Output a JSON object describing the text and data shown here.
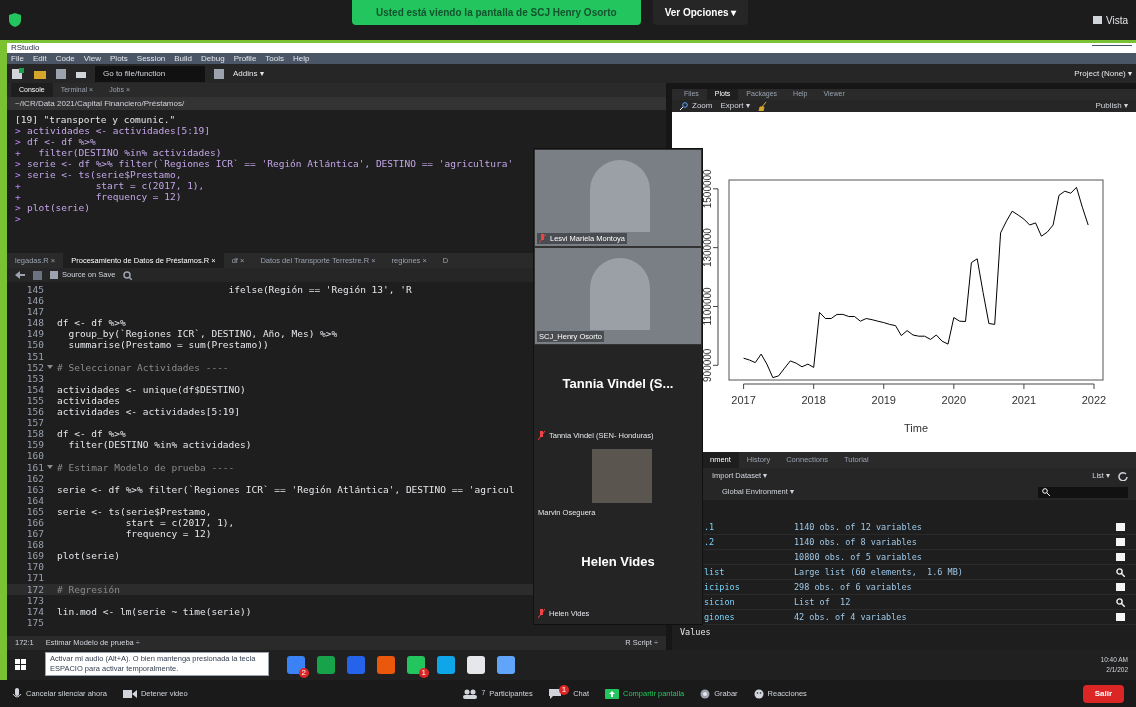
{
  "zoom_top": {
    "banner": "Usted está viendo la pantalla de SCJ Henry Osorto",
    "options_button": "Ver Opciones ▾",
    "view_button": "Vista"
  },
  "rstudio": {
    "window_title": "RStudio",
    "menu": [
      "File",
      "Edit",
      "Code",
      "View",
      "Plots",
      "Session",
      "Build",
      "Debug",
      "Profile",
      "Tools",
      "Help"
    ],
    "toolbar": {
      "goto_placeholder": "Go to file/function",
      "addins": "Addins ▾",
      "project": "Project (None) ▾"
    },
    "console": {
      "tabs": [
        {
          "label": "Console",
          "selected": true
        },
        {
          "label": "Terminal ×",
          "selected": false
        },
        {
          "label": "Jobs ×",
          "selected": false
        }
      ],
      "path": "~/ICR/Data 2021/Capital Financiero/Préstamos/",
      "lines": [
        {
          "text": "[19] \"transporte y comunic.\""
        },
        {
          "prompt": ">",
          "text": "actividades <- actividades[5:19]"
        },
        {
          "prompt": ">",
          "text": "df <- df %>%"
        },
        {
          "prompt": "+",
          "text": "  filter(DESTINO %in% actividades)"
        },
        {
          "prompt": ">",
          "text": "serie <- df %>% filter(`Regiones ICR` == 'Región Atlántica', DESTINO == 'agricultura'"
        },
        {
          "prompt": ">",
          "text": "serie <- ts(serie$Prestamo,"
        },
        {
          "prompt": "+",
          "text": "            start = c(2017, 1),"
        },
        {
          "prompt": "+",
          "text": "            frequency = 12)"
        },
        {
          "prompt": ">",
          "text": "plot(serie)"
        },
        {
          "prompt": ">"
        }
      ]
    },
    "editor": {
      "tabs": [
        {
          "label": "legadas.R ×",
          "selected": false
        },
        {
          "label": "Procesamiento de Datos de Préstamos.R ×",
          "selected": true
        },
        {
          "label": "df ×",
          "selected": false
        },
        {
          "label": "Datos del Transporte Terrestre.R ×",
          "selected": false
        },
        {
          "label": "regiones ×",
          "selected": false
        },
        {
          "label": "D",
          "selected": false
        }
      ],
      "source_on_save": {
        "label": "Source on Save",
        "checked": false
      },
      "lines": [
        {
          "number": "145",
          "text": "                              ifelse(Región == 'Región 13', 'R",
          "kind": "code",
          "fold": false,
          "current": false
        },
        {
          "number": "146",
          "fold": false,
          "current": false
        },
        {
          "number": "147",
          "fold": false,
          "current": false
        },
        {
          "number": "148",
          "text": "df <- df %>%",
          "kind": "code",
          "fold": false,
          "current": false
        },
        {
          "number": "149",
          "text": "  group_by(`Regiones ICR`, DESTINO, Año, Mes) %>%",
          "kind": "code",
          "fold": false,
          "current": false
        },
        {
          "number": "150",
          "text": "  summarise(Prestamo = sum(Prestamo))",
          "kind": "code",
          "fold": false,
          "current": false
        },
        {
          "number": "151",
          "fold": false,
          "current": false
        },
        {
          "number": "152",
          "text": "# Seleccionar Actividades ----",
          "kind": "comment",
          "fold": true,
          "current": false
        },
        {
          "number": "153",
          "fold": false,
          "current": false
        },
        {
          "number": "154",
          "text": "actividades <- unique(df$DESTINO)",
          "kind": "code",
          "fold": false,
          "current": false
        },
        {
          "number": "155",
          "text": "actividades",
          "kind": "code",
          "fold": false,
          "current": false
        },
        {
          "number": "156",
          "text": "actividades <- actividades[5:19]",
          "kind": "code",
          "fold": false,
          "current": false
        },
        {
          "number": "157",
          "fold": false,
          "current": false
        },
        {
          "number": "158",
          "text": "df <- df %>%",
          "kind": "code",
          "fold": false,
          "current": false
        },
        {
          "number": "159",
          "text": "  filter(DESTINO %in% actividades)",
          "kind": "code",
          "fold": false,
          "current": false
        },
        {
          "number": "160",
          "fold": false,
          "current": false
        },
        {
          "number": "161",
          "text": "# Estimar Modelo de prueba ----",
          "kind": "comment",
          "fold": true,
          "current": false
        },
        {
          "number": "162",
          "fold": false,
          "current": false
        },
        {
          "number": "163",
          "text": "serie <- df %>% filter(`Regiones ICR` == 'Región Atlántica', DESTINO == 'agricul",
          "kind": "code",
          "fold": false,
          "current": false
        },
        {
          "number": "164",
          "fold": false,
          "current": false
        },
        {
          "number": "165",
          "text": "serie <- ts(serie$Prestamo,",
          "kind": "code",
          "fold": false,
          "current": false
        },
        {
          "number": "166",
          "text": "            start = c(2017, 1),",
          "kind": "code",
          "fold": false,
          "current": false
        },
        {
          "number": "167",
          "text": "            frequency = 12)",
          "kind": "code",
          "fold": false,
          "current": false
        },
        {
          "number": "168",
          "fold": false,
          "current": false
        },
        {
          "number": "169",
          "text": "plot(serie)",
          "kind": "code",
          "fold": false,
          "current": false
        },
        {
          "number": "170",
          "fold": false,
          "current": false
        },
        {
          "number": "171",
          "fold": false,
          "current": false
        },
        {
          "number": "172",
          "text": "# Regresión",
          "kind": "comment",
          "fold": false,
          "current": true
        },
        {
          "number": "173",
          "fold": false,
          "current": false
        },
        {
          "number": "174",
          "text": "lin.mod <- lm(serie ~ time(serie))",
          "kind": "code",
          "fold": false,
          "current": false
        },
        {
          "number": "175",
          "fold": false,
          "current": false
        }
      ],
      "position": "172:1",
      "section": "Estimar Modelo de prueba ÷",
      "file_type": "R Script ÷"
    },
    "plots": {
      "tabs": [
        {
          "label": "Files",
          "selected": false
        },
        {
          "label": "Plots",
          "selected": true
        },
        {
          "label": "Packages",
          "selected": false
        },
        {
          "label": "Help",
          "selected": false
        },
        {
          "label": "Viewer",
          "selected": false
        }
      ],
      "zoom": "Zoom",
      "export": "Export ▾",
      "publish": "Publish ▾",
      "chart_data": {
        "type": "line",
        "xlabel": "Time",
        "xlim": [
          2017,
          2022
        ],
        "ylim": [
          850000,
          1530000
        ],
        "xticks": [
          2017,
          2018,
          2019,
          2020,
          2021,
          2022
        ],
        "yticks": [
          900000,
          1100000,
          1300000,
          1500000
        ],
        "x": [
          2017.0,
          2017.083,
          2017.167,
          2017.25,
          2017.333,
          2017.417,
          2017.5,
          2017.583,
          2017.667,
          2017.75,
          2017.833,
          2017.917,
          2018.0,
          2018.083,
          2018.167,
          2018.25,
          2018.333,
          2018.417,
          2018.5,
          2018.583,
          2018.667,
          2018.75,
          2018.833,
          2018.917,
          2019.0,
          2019.083,
          2019.167,
          2019.25,
          2019.333,
          2019.417,
          2019.5,
          2019.583,
          2019.667,
          2019.75,
          2019.833,
          2019.917,
          2020.0,
          2020.083,
          2020.167,
          2020.25,
          2020.333,
          2020.417,
          2020.5,
          2020.583,
          2020.667,
          2020.75,
          2020.833,
          2020.917,
          2021.0,
          2021.083,
          2021.167,
          2021.25,
          2021.333,
          2021.417,
          2021.5,
          2021.583,
          2021.667,
          2021.75,
          2021.833,
          2021.917
        ],
        "series": [
          {
            "color": "#000000",
            "values": [
              924000,
              918000,
              909000,
              938000,
              904000,
              858000,
              864000,
              890000,
              915000,
              907000,
              895000,
              904000,
              893000,
              1080000,
              1059000,
              1059000,
              1073000,
              1073000,
              1066000,
              1066000,
              1050000,
              1059000,
              1055000,
              1050000,
              1045000,
              1039000,
              1035000,
              1001000,
              1018000,
              1003000,
              999000,
              999000,
              988000,
              1003000,
              982000,
              972000,
              1062000,
              1050000,
              1049000,
              1249000,
              1262000,
              1147000,
              1042000,
              1039000,
              1350000,
              1390000,
              1424000,
              1411000,
              1397000,
              1377000,
              1384000,
              1339000,
              1353000,
              1377000,
              1478000,
              1492000,
              1485000,
              1505000,
              1438000,
              1377000
            ]
          }
        ]
      }
    },
    "environment": {
      "tabs": [
        {
          "label": "nment",
          "selected": true
        },
        {
          "label": "History",
          "selected": false
        },
        {
          "label": "Connections",
          "selected": false
        },
        {
          "label": "Tutorial",
          "selected": false
        }
      ],
      "import_dataset": "Import Dataset ▾",
      "scope": "Global Environment ▾",
      "list_view": "List ▾",
      "rows": [
        {
          "name": ".1",
          "value": "1140 obs. of 12 variables",
          "kind": "data"
        },
        {
          "name": ".2",
          "value": "1140 obs. of 8 variables",
          "kind": "data"
        },
        {
          "value": "10800 obs. of 5 variables",
          "kind": "data"
        },
        {
          "name": "list",
          "value": "Large list (60 elements,  1.6 MB)",
          "kind": "list"
        },
        {
          "name": "icipios",
          "value": "298 obs. of 6 variables",
          "kind": "data"
        },
        {
          "name": "sicion",
          "value": "List of  12",
          "kind": "list"
        },
        {
          "name": "giones",
          "value": "42 obs. of 4 variables",
          "kind": "data"
        }
      ],
      "values_header": "Values"
    }
  },
  "participants": [
    {
      "kind": "video",
      "name": "Lesvi Mariela Montoya",
      "muted": true
    },
    {
      "kind": "video",
      "name": "SCJ_Henry Osorto",
      "muted": false
    },
    {
      "kind": "name",
      "display_name": "Tannia Vindel (S...",
      "name": "Tannia Vindel (SEN- Honduras)",
      "muted": true
    },
    {
      "kind": "small_video",
      "name": "Marvin Oseguera",
      "muted": false
    },
    {
      "kind": "name",
      "display_name": "Helen Vides",
      "name": "Helen Vides",
      "muted": true
    }
  ],
  "taskbar": {
    "tooltip": "Activar mi audio (Alt+A). O bien mantenga presionada la tecla ESPACIO para activar temporalmente.",
    "apps": [
      {
        "color": "#3b82f6",
        "badge": "2"
      },
      {
        "color": "#16a34a"
      },
      {
        "color": "#2563eb"
      },
      {
        "color": "#ea580c"
      },
      {
        "color": "#22c55e",
        "badge": "1"
      },
      {
        "color": "#0ea5e9"
      },
      {
        "color": "#e5e7eb"
      },
      {
        "color": "#60a5fa"
      }
    ],
    "time": "10:40 AM",
    "date": "2/1/202"
  },
  "zoom_bottom": [
    {
      "kind": "mic",
      "label": "Cancelar silenciar ahora"
    },
    {
      "kind": "video",
      "label": "Detener video"
    },
    {
      "kind": "participants",
      "label": "Participantes",
      "count": "7"
    },
    {
      "kind": "chat",
      "label": "Chat",
      "badge": "1"
    },
    {
      "kind": "share",
      "label": "Compartir pantalla"
    },
    {
      "kind": "record",
      "label": "Grabar"
    },
    {
      "kind": "reactions",
      "label": "Reacciones"
    },
    {
      "kind": "leave",
      "label": "Salir"
    }
  ]
}
